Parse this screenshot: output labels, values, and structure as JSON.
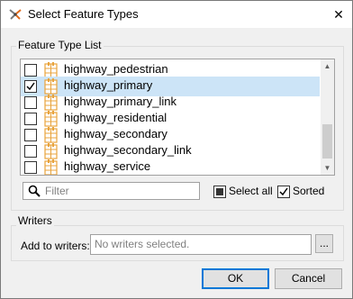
{
  "window": {
    "title": "Select Feature Types",
    "close_glyph": "✕"
  },
  "feature_list": {
    "group_label": "Feature Type List",
    "items": [
      {
        "label": "highway_pedestrian",
        "checked": false,
        "selected": false
      },
      {
        "label": "highway_primary",
        "checked": true,
        "selected": true
      },
      {
        "label": "highway_primary_link",
        "checked": false,
        "selected": false
      },
      {
        "label": "highway_residential",
        "checked": false,
        "selected": false
      },
      {
        "label": "highway_secondary",
        "checked": false,
        "selected": false
      },
      {
        "label": "highway_secondary_link",
        "checked": false,
        "selected": false
      },
      {
        "label": "highway_service",
        "checked": false,
        "selected": false
      }
    ],
    "scroll_up_glyph": "▲",
    "scroll_down_glyph": "▼"
  },
  "filter": {
    "placeholder": "Filter",
    "icon": "search-icon"
  },
  "select_all": {
    "label": "Select all",
    "state": "partial"
  },
  "sorted": {
    "label": "Sorted",
    "checked": true
  },
  "writers": {
    "group_label": "Writers",
    "add_label": "Add to writers:",
    "placeholder": "No writers selected.",
    "more_label": "..."
  },
  "buttons": {
    "ok": "OK",
    "cancel": "Cancel"
  },
  "colors": {
    "selection": "#cce4f7",
    "accent": "#0078d7",
    "feature_icon": "#e8a33c"
  }
}
